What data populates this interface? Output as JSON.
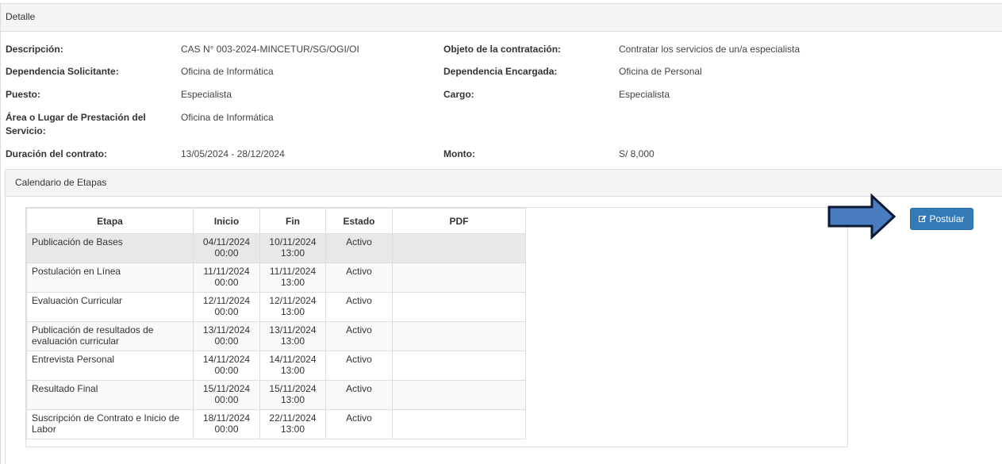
{
  "panel": {
    "title": "Detalle"
  },
  "details": {
    "descripcion_label": "Descripción:",
    "descripcion_value": "CAS N° 003-2024-MINCETUR/SG/OGI/OI",
    "objeto_label": "Objeto de la contratación:",
    "objeto_value": "Contratar los servicios de un/a especialista",
    "dep_solicitante_label": "Dependencia Solicitante:",
    "dep_solicitante_value": "Oficina de Informática",
    "dep_encargada_label": "Dependencia Encargada:",
    "dep_encargada_value": "Oficina de Personal",
    "puesto_label": "Puesto:",
    "puesto_value": "Especialista",
    "cargo_label": "Cargo:",
    "cargo_value": "Especialista",
    "area_label_1": "Área o Lugar de Prestación del",
    "area_label_2": "Servicio:",
    "area_value": "Oficina de Informática",
    "duracion_label": "Duración del contrato:",
    "duracion_value": "13/05/2024 - 28/12/2024",
    "monto_label": "Monto:",
    "monto_value": "S/ 8,000"
  },
  "calendar": {
    "title": "Calendario de Etapas",
    "headers": {
      "etapa": "Etapa",
      "inicio": "Inicio",
      "fin": "Fin",
      "estado": "Estado",
      "pdf": "PDF"
    },
    "rows": [
      {
        "etapa": [
          "Publicación de Bases"
        ],
        "inicio": [
          "04/11/2024",
          "00:00"
        ],
        "fin": [
          "10/11/2024",
          "13:00"
        ],
        "estado": "Activo",
        "pdf": ""
      },
      {
        "etapa": [
          "Postulación en Línea"
        ],
        "inicio": [
          "11/11/2024",
          "00:00"
        ],
        "fin": [
          "11/11/2024",
          "13:00"
        ],
        "estado": "Activo",
        "pdf": ""
      },
      {
        "etapa": [
          "Evaluación Curricular"
        ],
        "inicio": [
          "12/11/2024",
          "00:00"
        ],
        "fin": [
          "12/11/2024",
          "13:00"
        ],
        "estado": "Activo",
        "pdf": ""
      },
      {
        "etapa": [
          "Publicación de resultados de",
          "evaluación curricular"
        ],
        "inicio": [
          "13/11/2024",
          "00:00"
        ],
        "fin": [
          "13/11/2024",
          "13:00"
        ],
        "estado": "Activo",
        "pdf": ""
      },
      {
        "etapa": [
          "Entrevista Personal"
        ],
        "inicio": [
          "14/11/2024",
          "00:00"
        ],
        "fin": [
          "14/11/2024",
          "13:00"
        ],
        "estado": "Activo",
        "pdf": ""
      },
      {
        "etapa": [
          "Resultado Final"
        ],
        "inicio": [
          "15/11/2024",
          "00:00"
        ],
        "fin": [
          "15/11/2024",
          "13:00"
        ],
        "estado": "Activo",
        "pdf": ""
      },
      {
        "etapa": [
          "Suscripción de Contrato e Inicio de",
          "Labor"
        ],
        "inicio": [
          "18/11/2024",
          "00:00"
        ],
        "fin": [
          "22/11/2024",
          "13:00"
        ],
        "estado": "Activo",
        "pdf": ""
      }
    ]
  },
  "postular_button": {
    "label": "Postular",
    "icon": "edit-icon",
    "color": "#337ab7"
  },
  "annotation": {
    "icon": "arrow-right-icon",
    "fill": "#4a7cc0",
    "stroke": "#0e1a33"
  }
}
